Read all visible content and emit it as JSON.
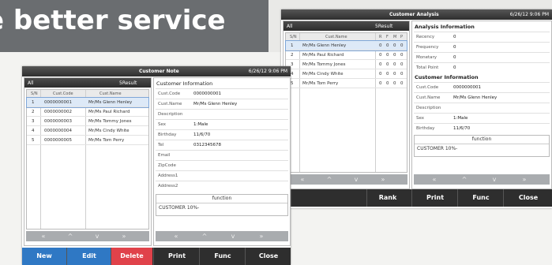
{
  "banner": {
    "text": "e better service"
  },
  "note": {
    "title": "Customer Note",
    "datetime": "6/26/12 9:06 PM",
    "list_label": "All",
    "result": "5Result",
    "col_sn": "S/N",
    "col_code": "Cust.Code",
    "col_name": "Cust.Name",
    "rows": [
      {
        "sn": "1",
        "code": "0000000001",
        "name": "Mr/Ms Glenn Henley"
      },
      {
        "sn": "2",
        "code": "0000000002",
        "name": "Mr/Ms Paul Richard"
      },
      {
        "sn": "3",
        "code": "0000000003",
        "name": "Mr/Ms Tommy Jones"
      },
      {
        "sn": "4",
        "code": "0000000004",
        "name": "Mr/Ms Cindy White"
      },
      {
        "sn": "5",
        "code": "0000000005",
        "name": "Mr/Ms Tom Perry"
      }
    ],
    "info_title": "Customer Information",
    "fields": [
      {
        "label": "Cust.Code",
        "value": "0000000001"
      },
      {
        "label": "Cust.Name",
        "value": "Mr/Ms Glenn Henley"
      },
      {
        "label": "Description",
        "value": ""
      },
      {
        "label": "Sex",
        "value": "1:Male"
      },
      {
        "label": "Birthday",
        "value": "11/6/70"
      },
      {
        "label": "Tel",
        "value": "0312345678"
      },
      {
        "label": "Email",
        "value": ""
      },
      {
        "label": "ZipCode",
        "value": ""
      },
      {
        "label": "Address1",
        "value": ""
      },
      {
        "label": "Address2",
        "value": ""
      }
    ],
    "function_label": "function",
    "function_value": "CUSTOMER 10%-",
    "buttons": {
      "new": "New",
      "edit": "Edit",
      "delete": "Delete",
      "print": "Print",
      "func": "Func",
      "close": "Close"
    },
    "colors": {
      "new": "#2f78c4",
      "edit": "#2f78c4",
      "delete": "#e0424a"
    }
  },
  "analysis": {
    "title": "Customer Analysis",
    "datetime": "6/26/12 9:06 PM",
    "list_label": "All",
    "result": "5Result",
    "col_sn": "S/N",
    "col_name": "Cust.Name",
    "col_r": "R",
    "col_f": "F",
    "col_m": "M",
    "col_p": "P",
    "rows": [
      {
        "sn": "1",
        "name": "Mr/Ms Glenn Henley",
        "r": "0",
        "f": "0",
        "m": "0",
        "p": "0"
      },
      {
        "sn": "2",
        "name": "Mr/Ms Paul Richard",
        "r": "0",
        "f": "0",
        "m": "0",
        "p": "0"
      },
      {
        "sn": "3",
        "name": "Mr/Ms Tommy Jones",
        "r": "0",
        "f": "0",
        "m": "0",
        "p": "0"
      },
      {
        "sn": "4",
        "name": "Mr/Ms Cindy White",
        "r": "0",
        "f": "0",
        "m": "0",
        "p": "0"
      },
      {
        "sn": "5",
        "name": "Mr/Ms Tom Perry",
        "r": "0",
        "f": "0",
        "m": "0",
        "p": "0"
      }
    ],
    "analysis_title": "Analysis Information",
    "afields": [
      {
        "label": "Recency",
        "value": "0"
      },
      {
        "label": "Frequency",
        "value": "0"
      },
      {
        "label": "Monetary",
        "value": "0"
      },
      {
        "label": "Total Point",
        "value": "0"
      }
    ],
    "info_title": "Customer Information",
    "fields": [
      {
        "label": "Cust.Code",
        "value": "0000000001"
      },
      {
        "label": "Cust.Name",
        "value": "Mr/Ms Glenn Henley"
      },
      {
        "label": "Description",
        "value": ""
      },
      {
        "label": "Sex",
        "value": "1:Male"
      },
      {
        "label": "Birthday",
        "value": "11/6/70"
      }
    ],
    "function_label": "function",
    "function_value": "CUSTOMER 10%-",
    "buttons": {
      "rank": "Rank",
      "print": "Print",
      "func": "Func",
      "close": "Close"
    }
  },
  "nav": {
    "first": "«",
    "prev": "^",
    "next": "v",
    "last": "»"
  }
}
